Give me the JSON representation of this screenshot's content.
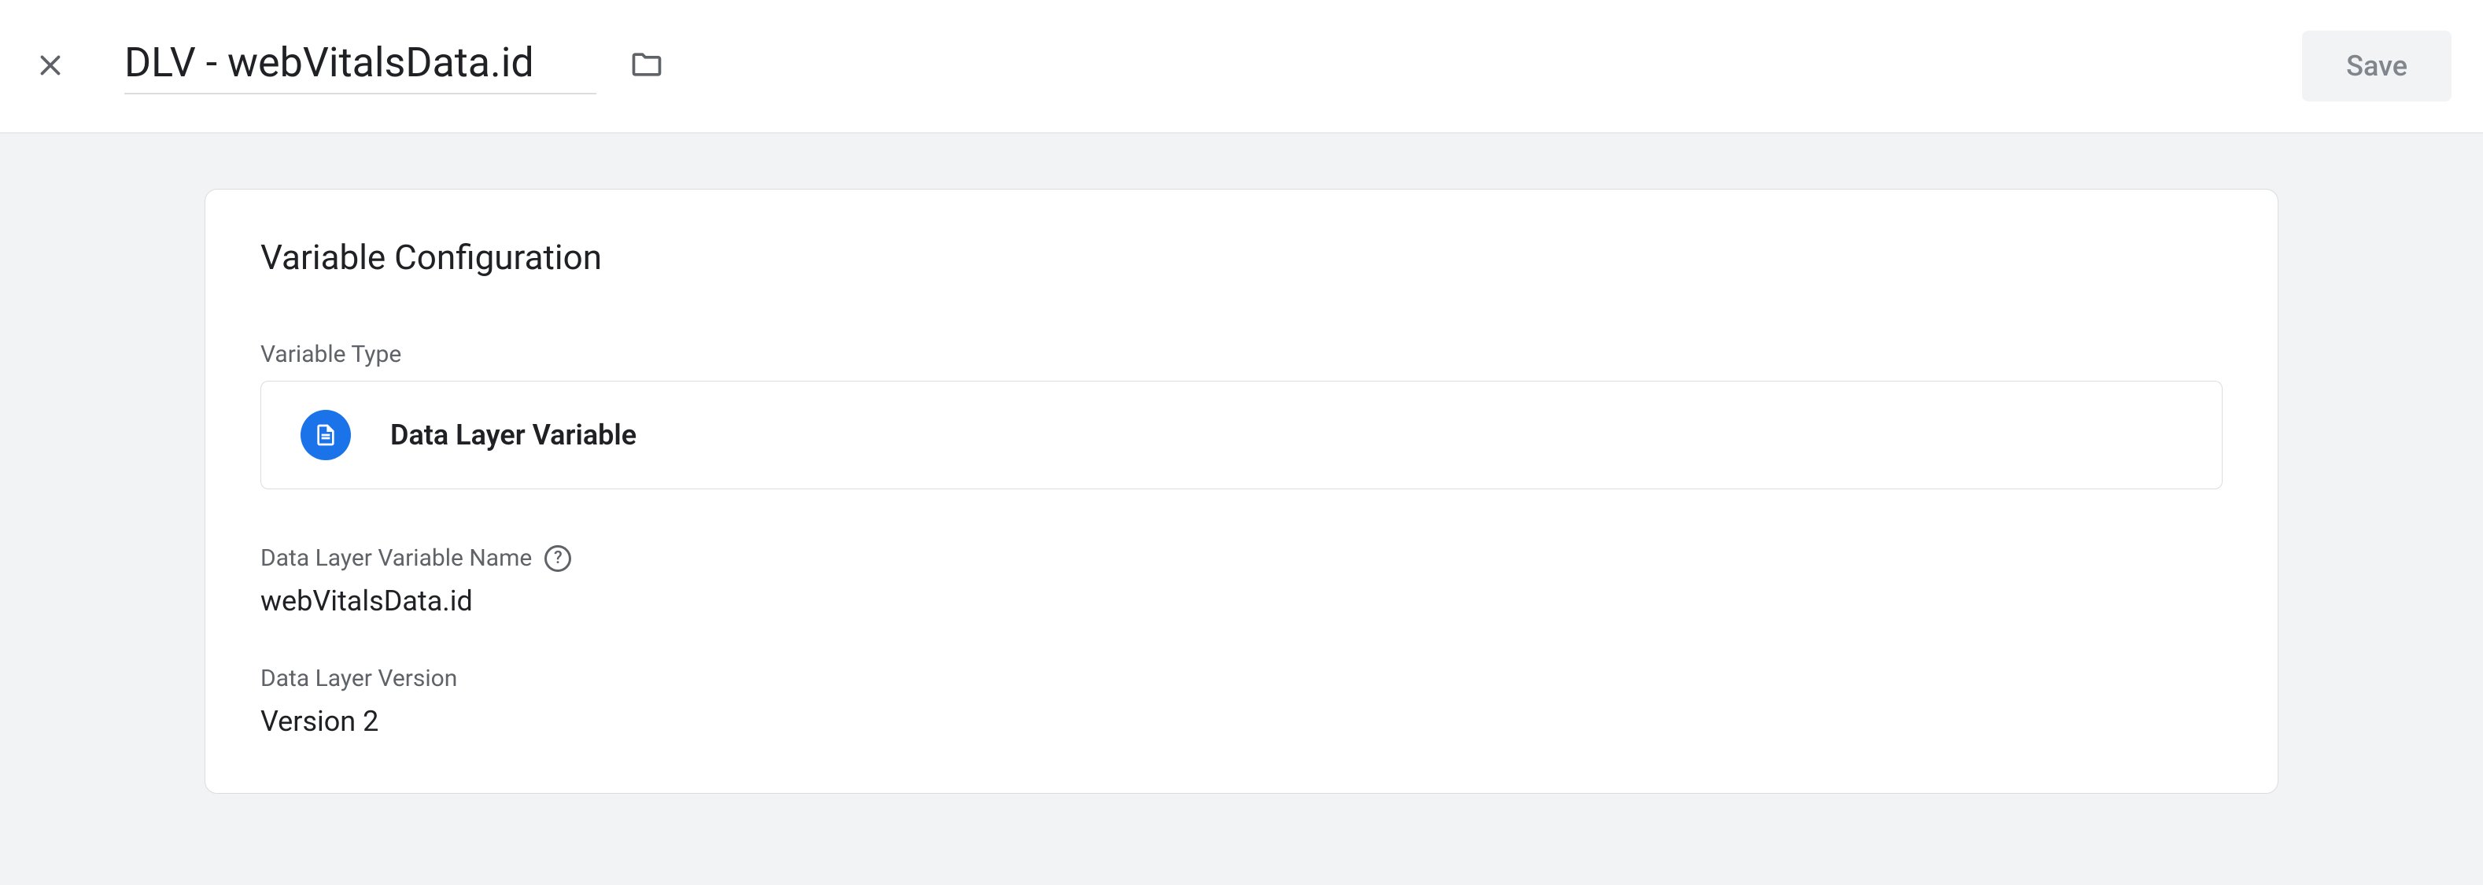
{
  "header": {
    "title": "DLV - webVitalsData.id",
    "save_label": "Save"
  },
  "card": {
    "title": "Variable Configuration",
    "type_label": "Variable Type",
    "type_value": "Data Layer Variable",
    "fields": {
      "name_label": "Data Layer Variable Name",
      "name_value": "webVitalsData.id",
      "version_label": "Data Layer Version",
      "version_value": "Version 2"
    }
  }
}
